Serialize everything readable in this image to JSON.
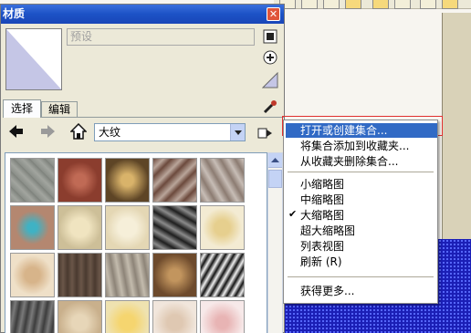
{
  "window": {
    "title": "材质"
  },
  "material": {
    "name_placeholder": "预设"
  },
  "tabs": [
    {
      "label": "选择"
    },
    {
      "label": "编辑"
    }
  ],
  "collection": {
    "selected": "大纹"
  },
  "menu": {
    "items": [
      {
        "label": "打开或创建集合...",
        "highlighted": true
      },
      {
        "label": "将集合添加到收藏夹..."
      },
      {
        "label": "从收藏夹删除集合..."
      },
      {
        "label": "小缩略图"
      },
      {
        "label": "中缩略图"
      },
      {
        "label": "大缩略图",
        "checked": true
      },
      {
        "label": "超大缩略图"
      },
      {
        "label": "列表视图"
      },
      {
        "label": "刷新 (R)"
      },
      {
        "label": "获得更多..."
      }
    ]
  },
  "colors": {
    "title_bar": "#1c52c6",
    "menu_highlight": "#316ac5",
    "annotation_outline": "#e03030",
    "viewport_plane": "#1b1fb6"
  },
  "icons": {
    "close": "close-icon",
    "back": "back-arrow-icon",
    "forward": "forward-arrow-icon",
    "home": "home-icon",
    "details": "details-arrow-icon",
    "eyedropper": "eyedropper-icon",
    "create_material": "create-material-icon",
    "paint_bucket": "paint-bucket-icon",
    "default_material": "default-material-icon"
  }
}
